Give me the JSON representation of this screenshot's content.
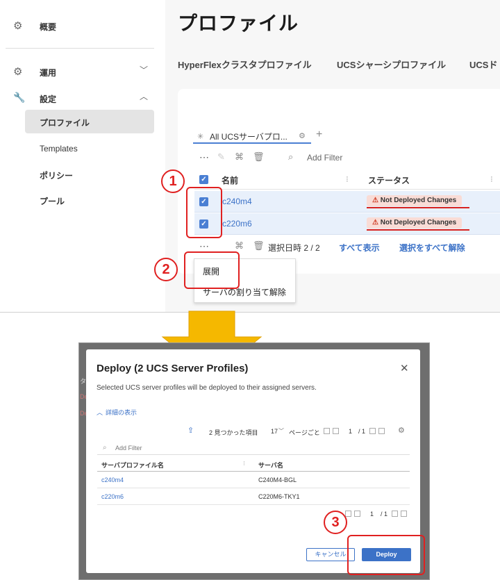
{
  "sidebar": {
    "overview": "概要",
    "operate": "運用",
    "configure": "設定",
    "items": [
      "プロファイル",
      "Templates",
      "ポリシー",
      "プール"
    ]
  },
  "page": {
    "title": "プロファイル",
    "tabs": [
      "HyperFlexクラスタプロファイル",
      "UCSシャーシプロファイル",
      "UCSド"
    ]
  },
  "filter": {
    "tab_label": "All UCSサーバプロ...",
    "placeholder": "Add Filter"
  },
  "table": {
    "columns": [
      "名前",
      "ステータス"
    ],
    "rows": [
      {
        "name": "c240m4",
        "status": "Not Deployed Changes"
      },
      {
        "name": "c220m6",
        "status": "Not Deployed Changes"
      }
    ]
  },
  "selection": {
    "count_label": "選択日時 2 / 2",
    "show_all": "すべて表示",
    "deselect_all": "選択をすべて解除"
  },
  "context_menu": {
    "deploy": "展開",
    "unassign": "サーバの割り当て解除"
  },
  "callouts": [
    "1",
    "2",
    "3"
  ],
  "dialog": {
    "title": "Deploy (2 UCS Server Profiles)",
    "description": "Selected UCS server profiles will be deployed to their assigned servers.",
    "details_toggle": "詳細の表示",
    "found_label": "2 見つかった項目",
    "per_page_value": "17",
    "per_page_label": "ページごと",
    "page_current": "1",
    "page_total": "/ 1",
    "filter_placeholder": "Add Filter",
    "columns": [
      "サーバプロファイル名",
      "サーバ名"
    ],
    "rows": [
      {
        "profile": "c240m4",
        "server": "C240M4-BGL"
      },
      {
        "profile": "c220m6",
        "server": "C220M6-TKY1"
      }
    ],
    "bottom_page_current": "1",
    "bottom_page_total": "/ 1",
    "cancel_label": "キャンセル",
    "deploy_label": "Deploy"
  },
  "background_fragments": [
    "タ",
    "De",
    "De"
  ],
  "colors": {
    "accent": "#3c72c7",
    "highlight_red": "#e02020",
    "arrow": "#f5b800",
    "row_selected": "#e8f0fb",
    "badge_bg": "#f9dcd6"
  }
}
